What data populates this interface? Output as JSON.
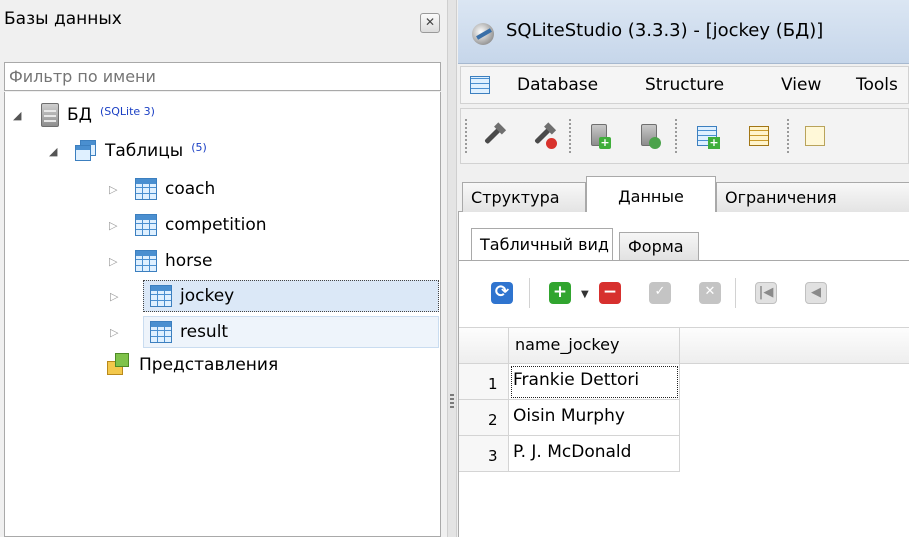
{
  "db_panel": {
    "title": "Базы данных",
    "close_glyph": "✕",
    "filter_placeholder": "Фильтр по имени",
    "tree": {
      "database": {
        "label": "БД",
        "badge": "(SQLite 3)"
      },
      "tables_group": {
        "label": "Таблицы",
        "badge": "(5)"
      },
      "tables": [
        {
          "label": "coach"
        },
        {
          "label": "competition"
        },
        {
          "label": "horse"
        },
        {
          "label": "jockey"
        },
        {
          "label": "result"
        }
      ],
      "views_group": {
        "label": "Представления"
      }
    }
  },
  "window": {
    "title": "SQLiteStudio (3.3.3) - [jockey (БД)]",
    "menu": [
      "Database",
      "Structure",
      "View",
      "Tools"
    ]
  },
  "toolbar": {
    "icons": [
      "connect-icon",
      "disconnect-icon",
      "add-database-icon",
      "sync-database-icon",
      "add-table-icon",
      "edit-table-icon",
      "partial-icon"
    ]
  },
  "tabs": [
    "Структура",
    "Данные",
    "Ограничения"
  ],
  "active_tab": "Данные",
  "subtabs": [
    "Табличный вид",
    "Форма"
  ],
  "grid_toolbar": {
    "icons": [
      "refresh-icon",
      "add-row-icon",
      "dropdown-arrow-icon",
      "delete-row-icon",
      "commit-icon",
      "rollback-icon",
      "first-page-icon",
      "prev-page-icon"
    ],
    "glyphs": {
      "refresh": "⟳",
      "add": "+",
      "drop": "▼",
      "del": "−",
      "ok": "✓",
      "cancel": "✕",
      "first": "|◀",
      "prev": "◀"
    }
  },
  "grid": {
    "columns": [
      "name_jockey"
    ],
    "rows": [
      {
        "num": "1",
        "values": [
          "Frankie Dettori"
        ]
      },
      {
        "num": "2",
        "values": [
          "Oisin Murphy"
        ]
      },
      {
        "num": "3",
        "values": [
          "P. J. McDonald"
        ]
      }
    ]
  },
  "colors": {
    "accent_blue": "#2f74cf",
    "add_green": "#31a52f",
    "delete_red": "#d7302e",
    "badge_blue": "#1a3fc4",
    "selection": "#dbe8f7"
  }
}
